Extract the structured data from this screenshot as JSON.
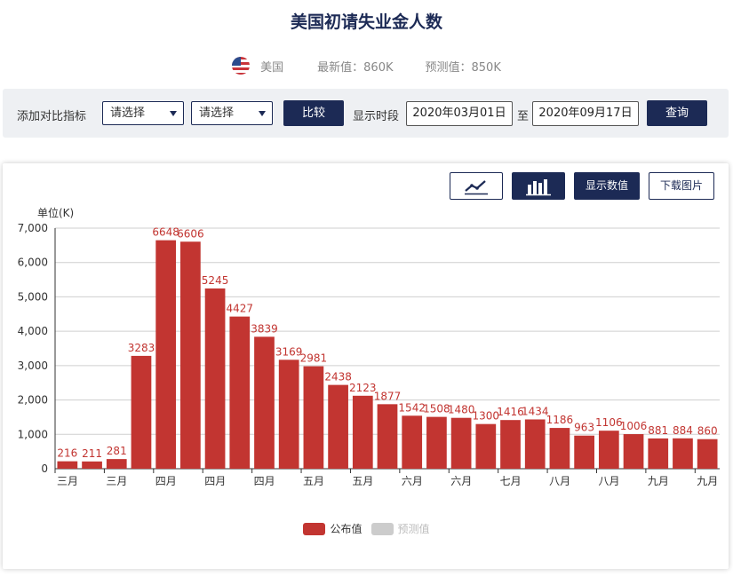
{
  "page": {
    "title": "美国初请失业金人数",
    "country": "美国",
    "latest_label": "最新值：860K",
    "forecast_label": "预测值：850K"
  },
  "toolbar": {
    "compare_label": "添加对比指标",
    "select1": "请选择",
    "select2": "请选择",
    "compare_button": "比较",
    "period_label": "显示时段",
    "start_date": "2020年03月01日",
    "to_label": "至",
    "end_date": "2020年09月17日",
    "query_button": "查询"
  },
  "chart_buttons": {
    "line_icon": "line-chart-icon",
    "bar_icon": "bar-chart-icon",
    "show_values": "显示数值",
    "download": "下载图片"
  },
  "colors": {
    "bar": "#c23531",
    "forecast": "#cccccc",
    "accent": "#1c2a55"
  },
  "chart_data": {
    "type": "bar",
    "unit_label": "单位(K)",
    "ylim": [
      0,
      7000
    ],
    "yticks": [
      0,
      1000,
      2000,
      3000,
      4000,
      5000,
      6000,
      7000
    ],
    "ytick_labels": [
      "0",
      "1,000",
      "2,000",
      "3,000",
      "4,000",
      "5,000",
      "6,000",
      "7,000"
    ],
    "grid": true,
    "categories": [
      "三月",
      "三月",
      "三月",
      "三月",
      "四月",
      "四月",
      "四月",
      "四月",
      "四月",
      "五月",
      "五月",
      "五月",
      "五月",
      "六月",
      "六月",
      "六月",
      "六月",
      "七月",
      "七月",
      "七月",
      "七月",
      "八月",
      "八月",
      "八月",
      "八月",
      "九月",
      "九月",
      "九月"
    ],
    "xtick_labels": [
      "三月",
      "三月",
      "四月",
      "四月",
      "四月",
      "五月",
      "五月",
      "六月",
      "六月",
      "七月",
      "八月",
      "八月",
      "九月",
      "九月"
    ],
    "series": [
      {
        "name": "公布值",
        "values": [
          216,
          211,
          281,
          3283,
          6648,
          6606,
          5245,
          4427,
          3839,
          3169,
          2981,
          2438,
          2123,
          1877,
          1542,
          1508,
          1480,
          1300,
          1416,
          1434,
          1186,
          963,
          1106,
          1006,
          881,
          884,
          860
        ]
      }
    ],
    "legend": [
      {
        "name": "公布值",
        "active": true
      },
      {
        "name": "预测值",
        "active": false
      }
    ],
    "legend_position": "bottom-center"
  }
}
